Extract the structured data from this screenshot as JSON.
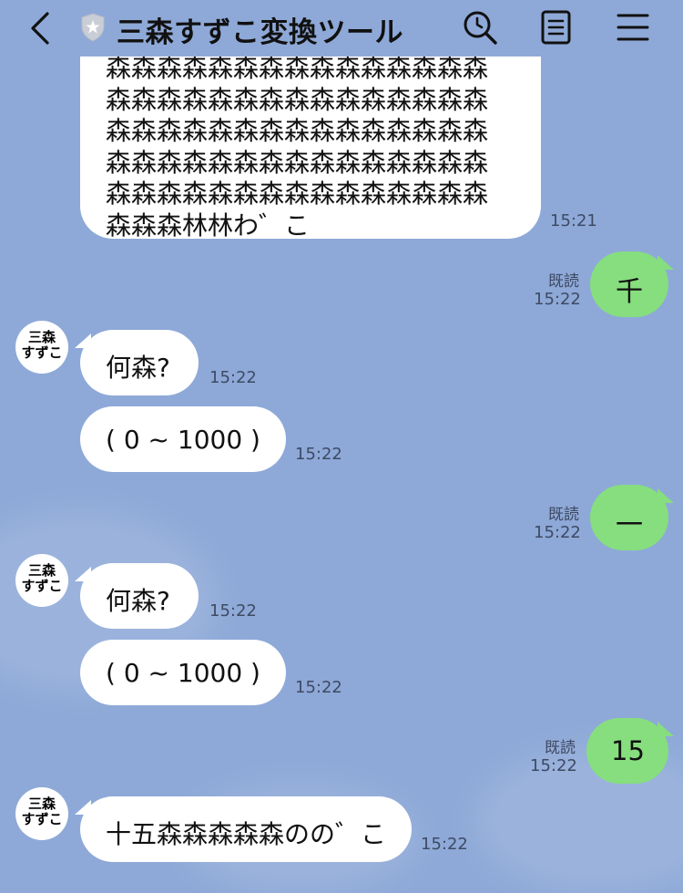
{
  "header": {
    "title": "三森すずこ変換ツール",
    "back_icon": "chevron-left-icon",
    "shield_icon": "shield-star-icon",
    "search_icon": "search-icon",
    "notes_icon": "notes-icon",
    "menu_icon": "menu-icon"
  },
  "colors": {
    "background": "#8EA9D8",
    "incoming_bubble": "#FFFFFF",
    "outgoing_bubble": "#86DE7E",
    "meta_text": "#3E4A63"
  },
  "messages": {
    "m1": {
      "lines": [
        "森森森森森森森森森森森森森森森",
        "森森森森森森森森森森森森森森森",
        "森森森森森森森森森森森森森森森",
        "森森森森森森森森森森森森森森森",
        "森森森森森森森森森森森森森森森",
        "森森森林林わ゛こ"
      ],
      "time": "15:21"
    },
    "m2": {
      "text": "千",
      "read": "既読",
      "time": "15:22"
    },
    "m3": {
      "sender": "三森\nすずこ",
      "text": "何森?",
      "time": "15:22"
    },
    "m4": {
      "text": "( 0 ~ 1000 )",
      "time": "15:22"
    },
    "m5": {
      "text": "一",
      "read": "既読",
      "time": "15:22"
    },
    "m6": {
      "sender": "三森\nすずこ",
      "text": "何森?",
      "time": "15:22"
    },
    "m7": {
      "text": "( 0 ~ 1000 )",
      "time": "15:22"
    },
    "m8": {
      "text": "15",
      "read": "既読",
      "time": "15:22"
    },
    "m9": {
      "sender": "三森\nすずこ",
      "text": "十五森森森森森のの゛こ",
      "time": "15:22"
    }
  }
}
